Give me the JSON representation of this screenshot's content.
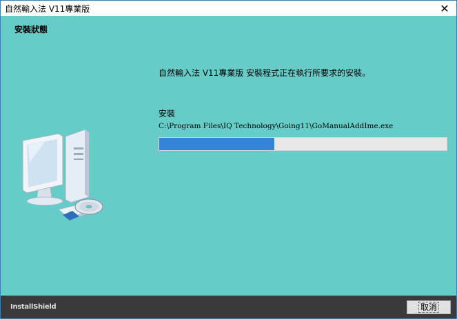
{
  "window": {
    "title": "自然輸入法 V11專業版",
    "close_glyph": "✕"
  },
  "header": {
    "title": "安裝狀態"
  },
  "main": {
    "message": "自然輸入法 V11專業版 安裝程式正在執行所要求的安裝。",
    "action_label": "安裝",
    "file_path": "C:\\Program Files\\IQ Technology\\Going11\\GoManualAddIme.exe",
    "progress_fraction": 0.4
  },
  "footer": {
    "brand": "InstallShield",
    "cancel_label": "取消"
  },
  "colors": {
    "background": "#66ccc8",
    "progress_fill": "#3584dc",
    "footer": "#3a3a3a"
  },
  "icons": {
    "computer": "computer-with-cd-icon",
    "close": "close-icon"
  }
}
